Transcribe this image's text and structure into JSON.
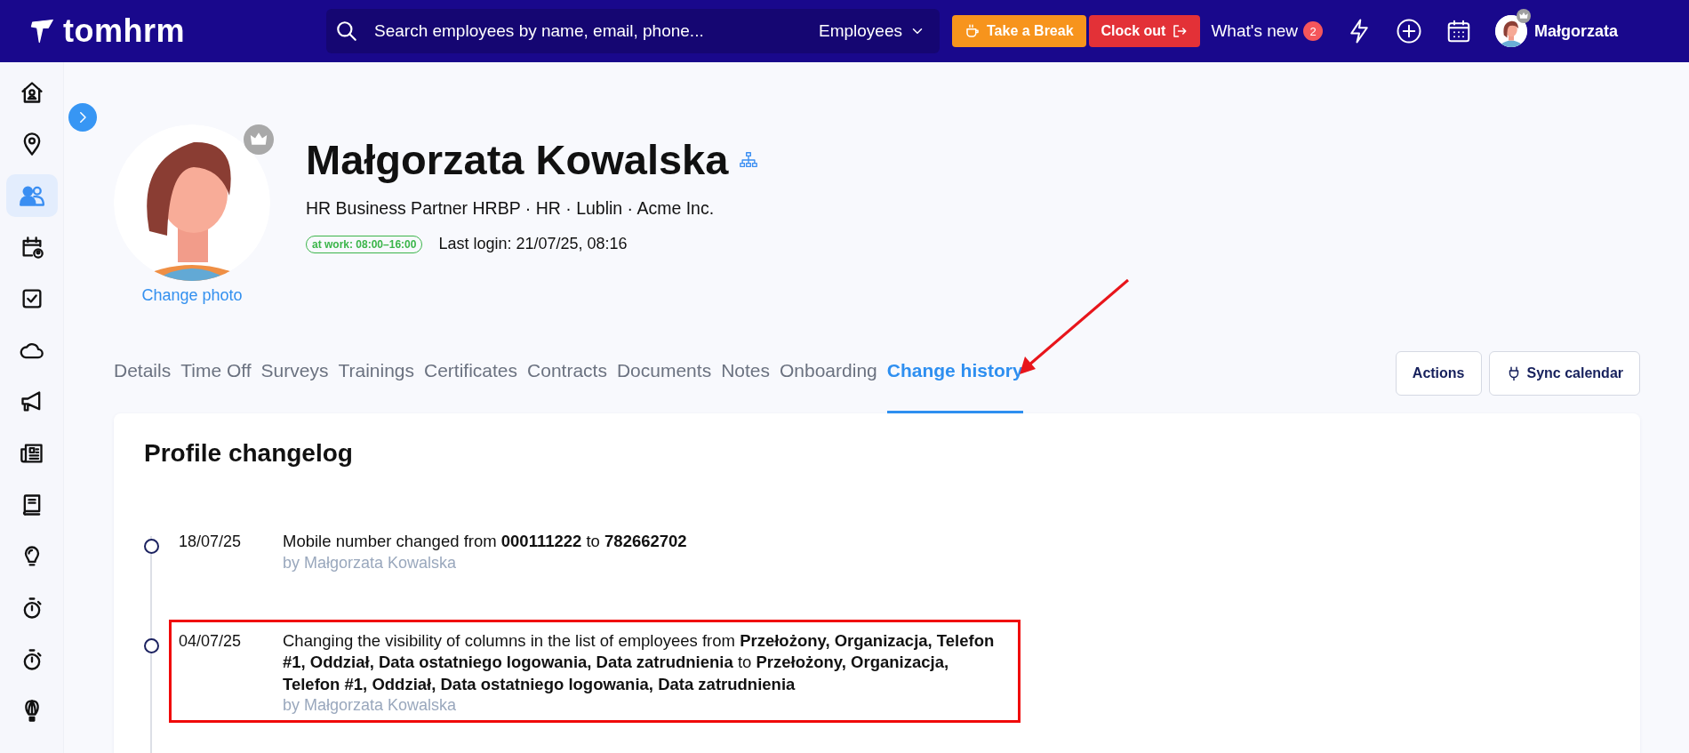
{
  "topbar": {
    "logo": "tomhrm",
    "search": {
      "placeholder": "Search employees by name, email, phone..."
    },
    "scope": "Employees",
    "buttons": [
      {
        "kind": "break",
        "label": "Take a Break"
      },
      {
        "kind": "clockout",
        "label": "Clock out"
      }
    ],
    "whats_new": {
      "label": "What's new",
      "count": "2"
    },
    "user": "Małgorzata"
  },
  "sidebar": {
    "items": [
      {
        "selected": false
      },
      {
        "selected": false
      },
      {
        "selected": true
      },
      {
        "selected": false
      },
      {
        "selected": false
      },
      {
        "selected": false
      },
      {
        "selected": false
      },
      {
        "selected": false
      },
      {
        "selected": false
      },
      {
        "selected": false
      },
      {
        "selected": false
      },
      {
        "selected": false
      },
      {
        "selected": false
      }
    ]
  },
  "profile": {
    "name": "Małgorzata Kowalska",
    "subtitle": "HR Business Partner HRBP · HR · Lublin · Acme Inc.",
    "status": "at work: 08:00–16:00",
    "last_login": "Last login: 21/07/25, 08:16",
    "change_photo": "Change photo"
  },
  "tabs": [
    {
      "label": "Details",
      "selected": false,
      "pointed": false
    },
    {
      "label": "Time Off",
      "selected": false,
      "pointed": false
    },
    {
      "label": "Surveys",
      "selected": false,
      "pointed": false
    },
    {
      "label": "Trainings",
      "selected": false,
      "pointed": false
    },
    {
      "label": "Certificates",
      "selected": false,
      "pointed": false
    },
    {
      "label": "Contracts",
      "selected": false,
      "pointed": false
    },
    {
      "label": "Documents",
      "selected": false,
      "pointed": false
    },
    {
      "label": "Notes",
      "selected": false,
      "pointed": false
    },
    {
      "label": "Onboarding",
      "selected": false,
      "pointed": false
    },
    {
      "label": "Change history",
      "selected": true,
      "pointed": true
    }
  ],
  "actions": [
    {
      "kind": "plain",
      "label": "Actions"
    },
    {
      "kind": "sync",
      "label": "Sync calendar"
    }
  ],
  "changelog": {
    "title": "Profile changelog",
    "entries": [
      {
        "date": "18/07/25",
        "text": "Mobile number changed from **000111222** to **782662702**",
        "author": "by Małgorzata Kowalska",
        "highlighted": false
      },
      {
        "date": "04/07/25",
        "text": "Changing the visibility of columns in the list of employees from **Przełożony, Organizacja, Telefon #1, Oddział, Data ostatniego logowania, Data zatrudnienia** to **Przełożony, Organizacja, Telefon #1, Oddział, Data ostatniego logowania, Data zatrudnienia**",
        "author": "by Małgorzata Kowalska",
        "highlighted": true
      }
    ]
  }
}
